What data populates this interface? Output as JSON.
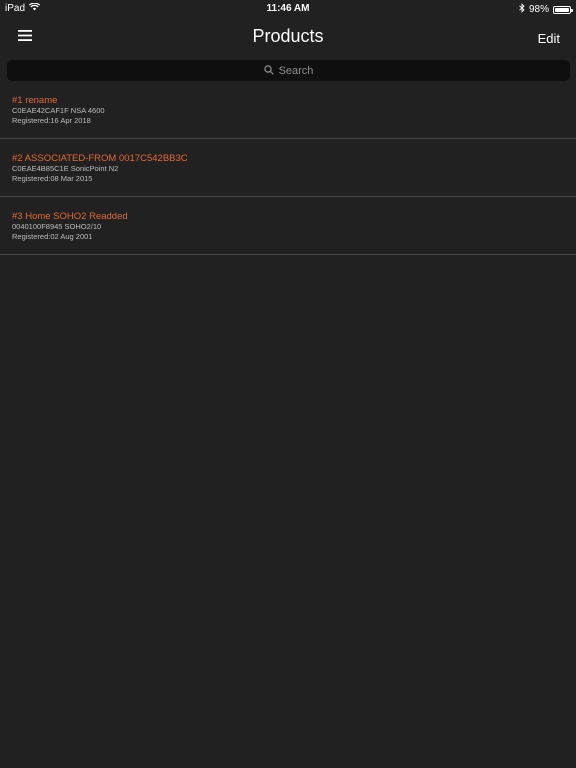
{
  "status_bar": {
    "device": "iPad",
    "time": "11:46 AM",
    "battery_percent": "98%",
    "battery_level": 0.98
  },
  "nav": {
    "title": "Products",
    "edit_label": "Edit"
  },
  "search": {
    "placeholder": "Search"
  },
  "products": [
    {
      "title": "#1 rename",
      "serial_model": "C0EAE42CAF1F NSA 4600",
      "registered": "Registered:16 Apr 2018"
    },
    {
      "title": "#2 ASSOCIATED-FROM 0017C542BB3C",
      "serial_model": "C0EAE4B85C1E SonicPoint N2",
      "registered": "Registered:08 Mar 2015"
    },
    {
      "title": "#3 Home SOHO2 Readded",
      "serial_model": "0040100F8945 SOHO2/10",
      "registered": "Registered:02 Aug 2001"
    }
  ],
  "colors": {
    "background": "#212121",
    "accent": "#e2692c",
    "search_bg": "#0f0f0f"
  },
  "icons": {
    "menu": "hamburger-menu-icon",
    "search": "search-icon",
    "wifi": "wifi-icon",
    "bluetooth": "bluetooth-icon",
    "battery": "battery-icon"
  }
}
